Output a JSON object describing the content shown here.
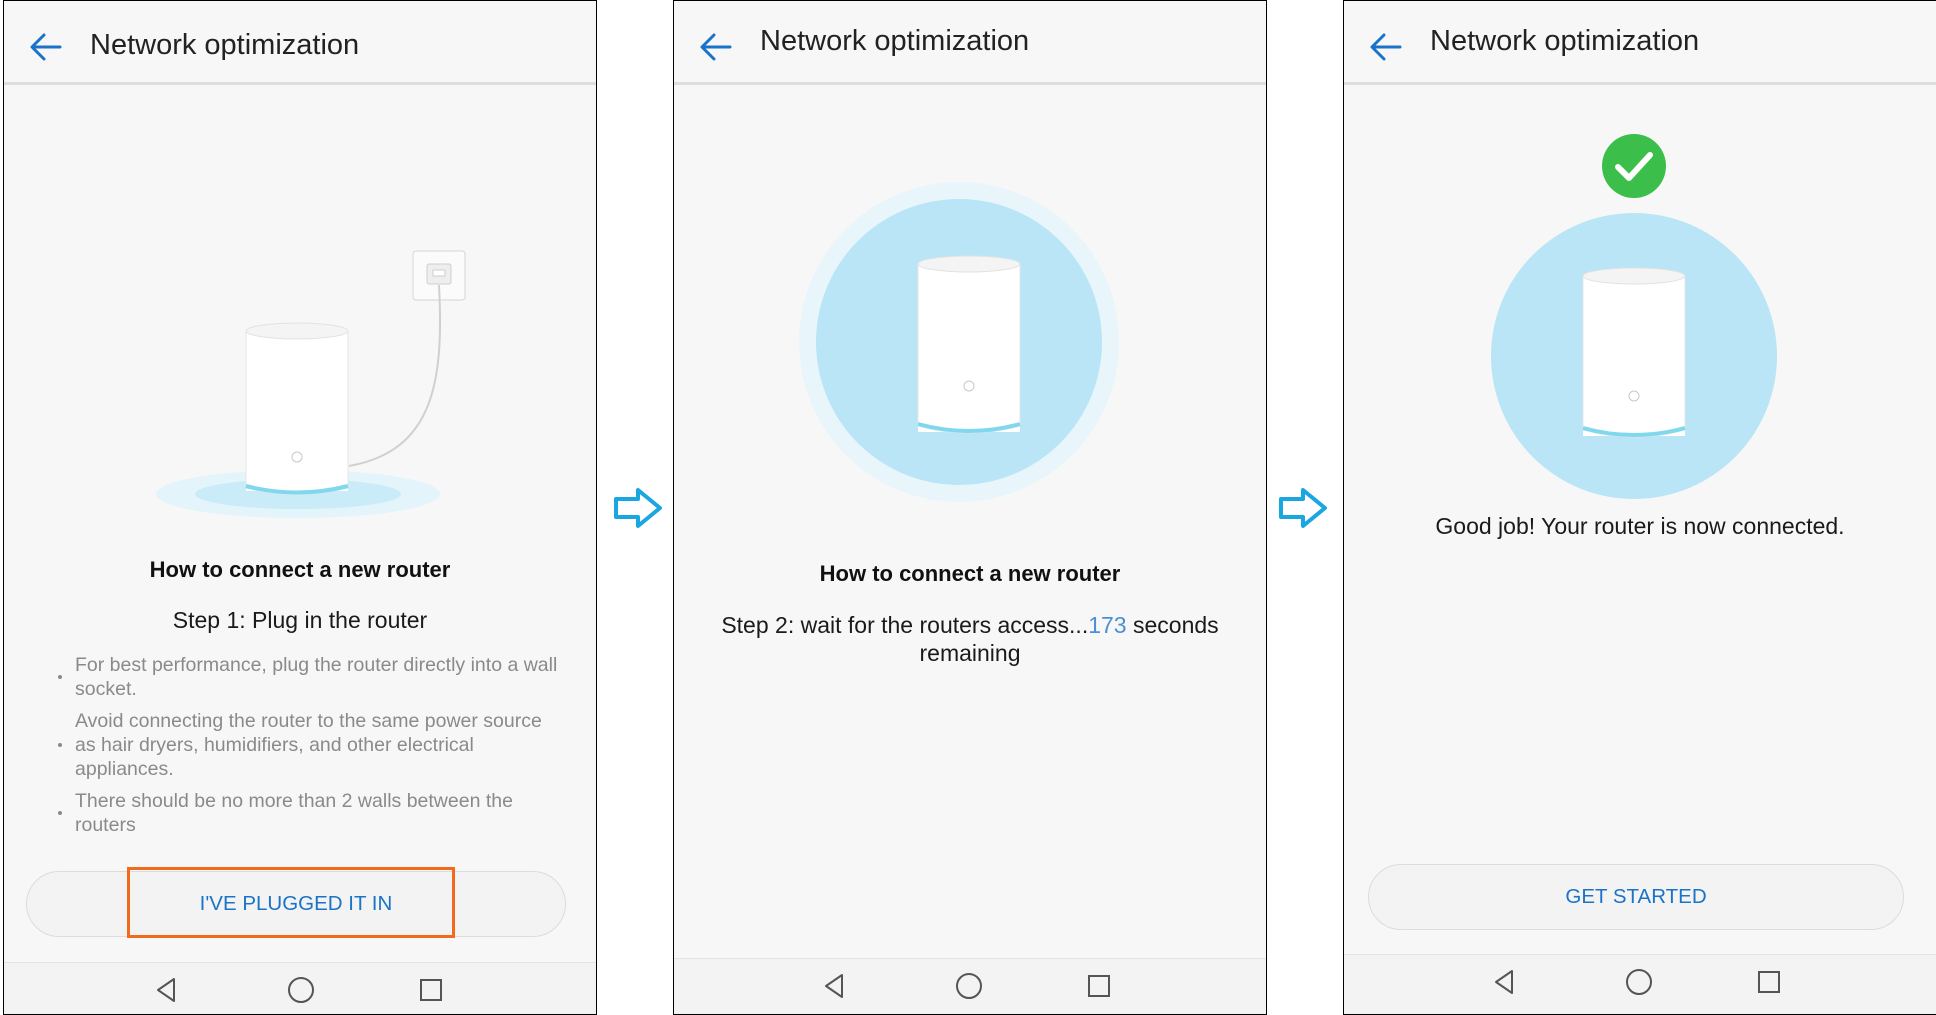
{
  "screens": [
    {
      "header": {
        "title": "Network optimization"
      },
      "heading": "How to connect a new router",
      "step": "Step 1: Plug in the router",
      "bullets": [
        "For best performance, plug the router directly into a wall socket.",
        "Avoid connecting the router to the same power source as hair dryers, humidifiers, and other electrical appliances.",
        "There should be no more than 2 walls between the routers"
      ],
      "button": "I'VE PLUGGED IT IN"
    },
    {
      "header": {
        "title": "Network optimization"
      },
      "heading": "How to connect a new router",
      "step_prefix": "Step 2: wait for the routers access...",
      "countdown": "173",
      "step_suffix": " seconds remaining"
    },
    {
      "header": {
        "title": "Network optimization"
      },
      "message": "Good job! Your router is now connected.",
      "button": "GET STARTED"
    }
  ],
  "icons": {
    "back": "arrow-left-icon",
    "flow": "arrow-right-icon",
    "success": "checkmark-icon",
    "nav": [
      "triangle-back-icon",
      "circle-home-icon",
      "square-recents-icon"
    ]
  },
  "colors": {
    "accent": "#1a73c8",
    "highlight": "#f26b1d",
    "success": "#3cbf4a",
    "halo": "#bde7f7",
    "flow_arrow": "#1aa6e0"
  }
}
